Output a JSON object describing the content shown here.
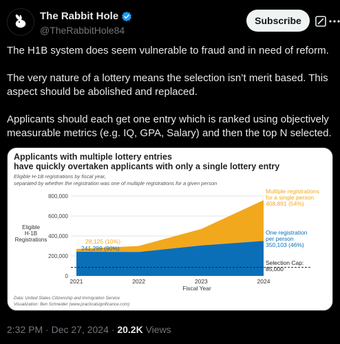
{
  "author": {
    "display_name": "The Rabbit Hole",
    "handle": "@TheRabbitHole84",
    "avatar_icon": "rabbit-icon",
    "verified_icon": "verified-badge-icon",
    "verified_color": "#1d9bf0"
  },
  "actions": {
    "subscribe_label": "Subscribe",
    "grok_icon": "grok-icon",
    "more_icon": "more-icon"
  },
  "tweet": {
    "paragraphs": [
      "The H1B system does seem vulnerable to fraud and in need of reform.",
      "The very nature of a lottery means the selection isn’t merit based. This aspect should be abolished and replaced.",
      "Applicants should each get one entry which is ranked using objectively measurable metrics (e.g. IQ, GPA, Salary) and then the top N selected."
    ],
    "time": "2:32 PM",
    "date": "Dec 27, 2024",
    "separator": "·",
    "views_count": "20.2K",
    "views_label": "Views"
  },
  "chart_data": {
    "type": "area",
    "title_line1": "Applicants with multiple lottery entries",
    "title_line2": "have quickly overtaken applicants with only a single lottery entry",
    "subtitle_line1": "Eligible H-1B registrations by fiscal year,",
    "subtitle_line2": "separated by whether the registration was one of multiple registrations for a given person",
    "xlabel": "Fiscal Year",
    "ylabel_lines": [
      "Eligible",
      "H-1B",
      "Registrations"
    ],
    "x": [
      "2021",
      "2022",
      "2023",
      "2024"
    ],
    "y_ticks": [
      "0",
      "200,000",
      "400,000",
      "600,000",
      "800,000"
    ],
    "ylim": [
      0,
      800000
    ],
    "series": [
      {
        "key": "single",
        "values": [
          241299,
          240000,
          305000,
          350103
        ],
        "color": "#0b6fb8"
      },
      {
        "key": "multiple",
        "values": [
          28125,
          60000,
          165000,
          408891
        ],
        "color": "#f2a81d"
      }
    ],
    "annotations": {
      "multiple_2021": "28,125 (10%)",
      "single_2021": "241,299 (90%)",
      "multiple_2024_lines": [
        "Multiple registrations",
        "for a single person",
        "408,891 (54%)"
      ],
      "single_2024_lines": [
        "One registration",
        "per person",
        "350,103 (46%)"
      ],
      "cap_lines": [
        "Selection Cap:",
        "85,000"
      ]
    },
    "selection_cap": 85000,
    "source_line1": "Data: United States Citizenship and Immigration Service",
    "source_line2": "Visualization: Ben Schneider (www.practicalsignificance.com)"
  }
}
